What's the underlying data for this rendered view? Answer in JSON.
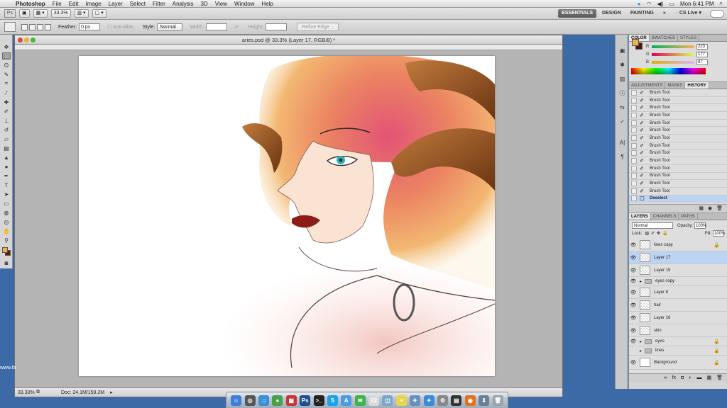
{
  "menubar": {
    "app": "Photoshop",
    "items": [
      "File",
      "Edit",
      "Image",
      "Layer",
      "Select",
      "Filter",
      "Analysis",
      "3D",
      "View",
      "Window",
      "Help"
    ],
    "clock": "Mon 6:41 PM"
  },
  "appbar": {
    "zoom": "33.3%",
    "workspaces": [
      "ESSENTIALS",
      "DESIGN",
      "PAINTING"
    ],
    "more": "»",
    "cs_live": "CS Live"
  },
  "options": {
    "feather_label": "Feather:",
    "feather_value": "0 px",
    "antialias_label": "Anti-alias",
    "style_label": "Style:",
    "style_value": "Normal",
    "width_label": "Width:",
    "height_label": "Height:",
    "refine_edge": "Refine Edge..."
  },
  "document": {
    "title": "aries.psd @ 33.3% (Layer 17, RGB/8) *",
    "status_zoom": "33.33%",
    "status_doc": "Doc: 24.1M/159.2M"
  },
  "color_panel": {
    "tabs": [
      "COLOR",
      "SWATCHES",
      "STYLES"
    ],
    "active_tab": "COLOR",
    "r_label": "R",
    "g_label": "G",
    "b_label": "B",
    "r": "223",
    "g": "177",
    "b": "87",
    "fg_color": "#f0b050",
    "bg_color": "#4b1610"
  },
  "history_panel": {
    "tabs": [
      "ADJUSTMENTS",
      "MASKS",
      "HISTORY"
    ],
    "active_tab": "HISTORY",
    "items": [
      "Brush Tool",
      "Brush Tool",
      "Brush Tool",
      "Brush Tool",
      "Brush Tool",
      "Brush Tool",
      "Brush Tool",
      "Brush Tool",
      "Brush Tool",
      "Brush Tool",
      "Brush Tool",
      "Brush Tool",
      "Brush Tool",
      "Brush Tool",
      "Deselect"
    ],
    "selected": "Deselect"
  },
  "layers_panel": {
    "tabs": [
      "LAYERS",
      "CHANNELS",
      "PATHS"
    ],
    "active_tab": "LAYERS",
    "blend_mode": "Normal",
    "opacity_label": "Opacity:",
    "opacity": "100%",
    "lock_label": "Lock:",
    "fill_label": "Fill:",
    "fill": "100%",
    "layers": [
      {
        "name": "lines copy",
        "type": "layer",
        "locked": true
      },
      {
        "name": "Layer 17",
        "type": "layer",
        "selected": true
      },
      {
        "name": "Layer 15",
        "type": "layer"
      },
      {
        "name": "eyes copy",
        "type": "group"
      },
      {
        "name": "Layer 8",
        "type": "layer"
      },
      {
        "name": "hair",
        "type": "layer"
      },
      {
        "name": "Layer 16",
        "type": "layer"
      },
      {
        "name": "skin",
        "type": "layer"
      },
      {
        "name": "eyes",
        "type": "group",
        "locked": true
      },
      {
        "name": "lines",
        "type": "group",
        "locked": true
      },
      {
        "name": "Background",
        "type": "layer",
        "locked": true,
        "italic": true
      }
    ]
  },
  "dock": {
    "apps": [
      {
        "name": "finder",
        "color": "#3d7fd8",
        "glyph": "☺"
      },
      {
        "name": "dashboard",
        "color": "#555555",
        "glyph": "◎"
      },
      {
        "name": "itunes",
        "color": "#3b8fd6",
        "glyph": "♫"
      },
      {
        "name": "chrome",
        "color": "#4aa14a",
        "glyph": "●"
      },
      {
        "name": "ical",
        "color": "#cc3333",
        "glyph": "▦"
      },
      {
        "name": "photoshop",
        "color": "#1c4f8c",
        "glyph": "Ps"
      },
      {
        "name": "terminal",
        "color": "#222222",
        "glyph": ">_"
      },
      {
        "name": "skype",
        "color": "#1aa3e8",
        "glyph": "S"
      },
      {
        "name": "app-store",
        "color": "#4b9be0",
        "glyph": "A"
      },
      {
        "name": "messages",
        "color": "#3fb24a",
        "glyph": "✉"
      },
      {
        "name": "calendar",
        "color": "#d9d9d9",
        "glyph": "22"
      },
      {
        "name": "preview",
        "color": "#7aa7c7",
        "glyph": "◫"
      },
      {
        "name": "stickies",
        "color": "#e8d44d",
        "glyph": "≡"
      },
      {
        "name": "mail",
        "color": "#6a8fb8",
        "glyph": "✈"
      },
      {
        "name": "safari",
        "color": "#3b8ad9",
        "glyph": "✦"
      },
      {
        "name": "system-prefs",
        "color": "#888888",
        "glyph": "⚙"
      },
      {
        "name": "activity",
        "color": "#333333",
        "glyph": "▤"
      },
      {
        "name": "firefox",
        "color": "#e1731f",
        "glyph": "◉"
      },
      {
        "name": "downloads",
        "color": "#6b7f95",
        "glyph": "⬇"
      },
      {
        "name": "trash",
        "color": "#9aa4ad",
        "glyph": "🗑"
      }
    ]
  },
  "left_edge_text": "www.fa"
}
